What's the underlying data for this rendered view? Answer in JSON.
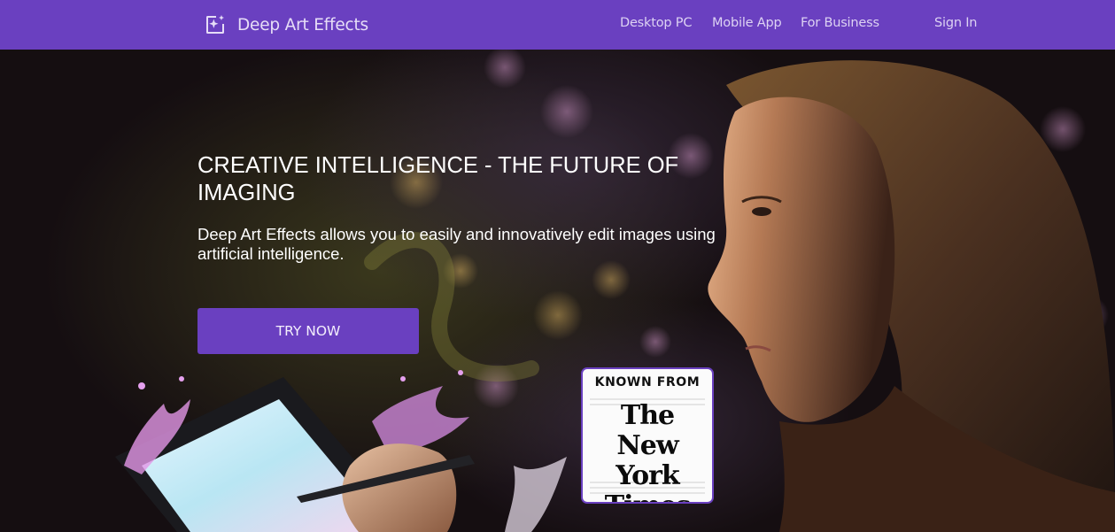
{
  "brand": {
    "name": "Deep Art Effects",
    "icon": "sparkle-frame-icon"
  },
  "nav": {
    "links": [
      "Desktop PC",
      "Mobile App",
      "For Business"
    ],
    "sign_in": "Sign In"
  },
  "hero": {
    "headline": "CREATIVE INTELLIGENCE - THE FUTURE OF IMAGING",
    "subline": "Deep Art Effects allows you to easily and innovatively edit images using artificial intelligence.",
    "cta_label": "TRY NOW",
    "background_image": "woman-with-tablet-paint-splash"
  },
  "badge": {
    "heading": "KNOWN FROM",
    "logo_text": "The New York Times"
  },
  "colors": {
    "accent": "#6a40c0",
    "hero_bg": "#140d10",
    "text": "#ffffff"
  }
}
